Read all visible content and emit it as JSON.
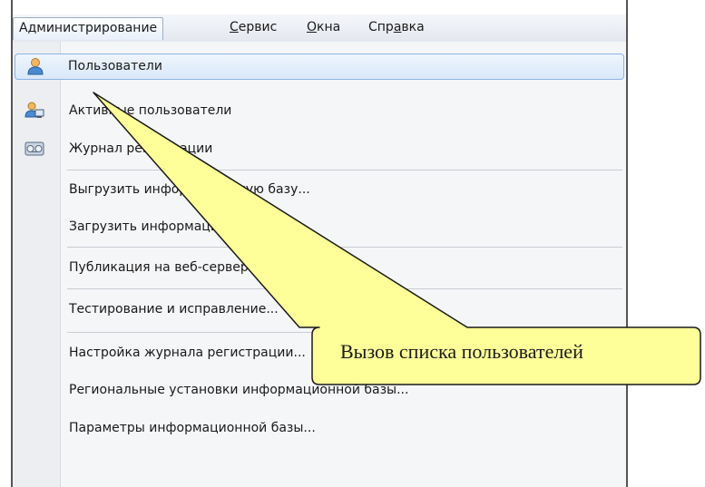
{
  "menubar": {
    "items": [
      {
        "label": "Администрирование",
        "active": true
      },
      {
        "pre": "",
        "ul": "С",
        "post": "ервис"
      },
      {
        "pre": "",
        "ul": "О",
        "post": "кна"
      },
      {
        "pre": "Спр",
        "ul": "а",
        "post": "вка"
      }
    ]
  },
  "dropdown": {
    "items": [
      {
        "label": "Пользователи",
        "icon": "user-icon"
      },
      {
        "label": "Активные пользователи",
        "icon": "active-users-icon"
      },
      {
        "label": "Журнал регистрации",
        "icon": "log-journal-icon"
      },
      {
        "label": "Выгрузить информационную базу..."
      },
      {
        "label": "Загрузить информационную базу..."
      },
      {
        "label": "Публикация на веб-сервере..."
      },
      {
        "label": "Тестирование и исправление..."
      },
      {
        "label": "Настройка журнала регистрации..."
      },
      {
        "label": "Региональные установки информационной базы..."
      },
      {
        "label": "Параметры информационной базы..."
      }
    ]
  },
  "callout": {
    "text": "Вызов списка пользователей",
    "color": "#ffff99"
  },
  "colors": {
    "highlight_border": "#8fb3e0",
    "highlight_fill": "#d9e8fa"
  }
}
